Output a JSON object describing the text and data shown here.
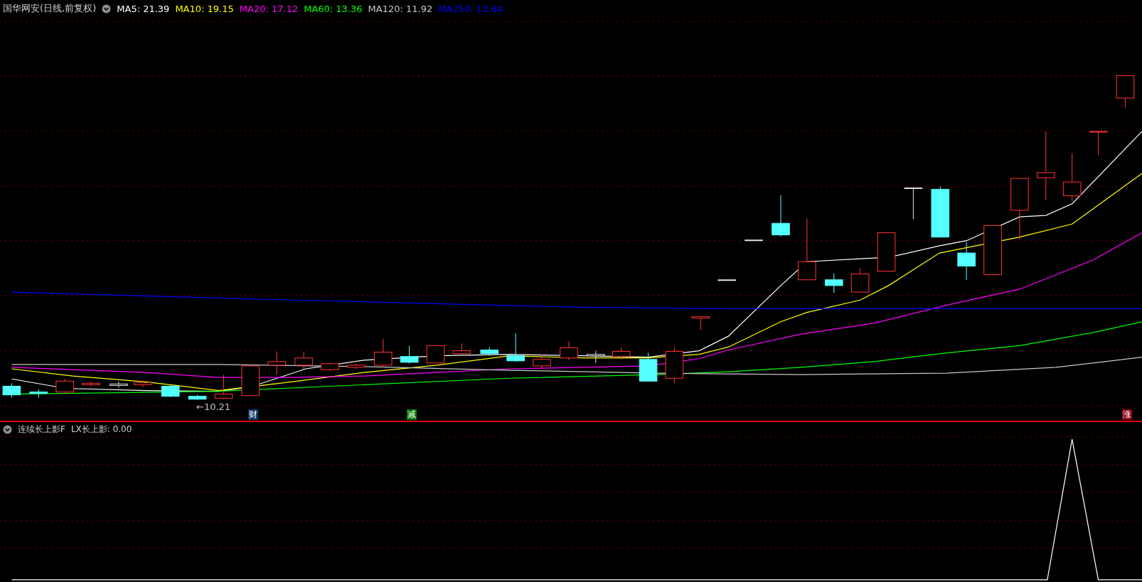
{
  "main_panel": {
    "title": "国华网安(日线,前复权)",
    "ma_legend": [
      {
        "label": "MA5: 21.39",
        "color": "#ffffff"
      },
      {
        "label": "MA10: 19.15",
        "color": "#ffff00"
      },
      {
        "label": "MA20: 17.12",
        "color": "#ff00ff"
      },
      {
        "label": "MA60: 13.36",
        "color": "#00ff00"
      },
      {
        "label": "MA120: 11.92",
        "color": "#c8c8c8"
      },
      {
        "label": "MA250: 13.64",
        "color": "#0000ff"
      }
    ],
    "price_marker": "←10.21",
    "event_badges": [
      {
        "label": "财",
        "color": "#0c3a66"
      },
      {
        "label": "减",
        "color": "#0a7a0a"
      },
      {
        "label": "涨",
        "color": "#8a0010"
      }
    ]
  },
  "indicator_panel": {
    "title": "连续长上影F",
    "reading": "LX长上影: 0.00"
  }
}
